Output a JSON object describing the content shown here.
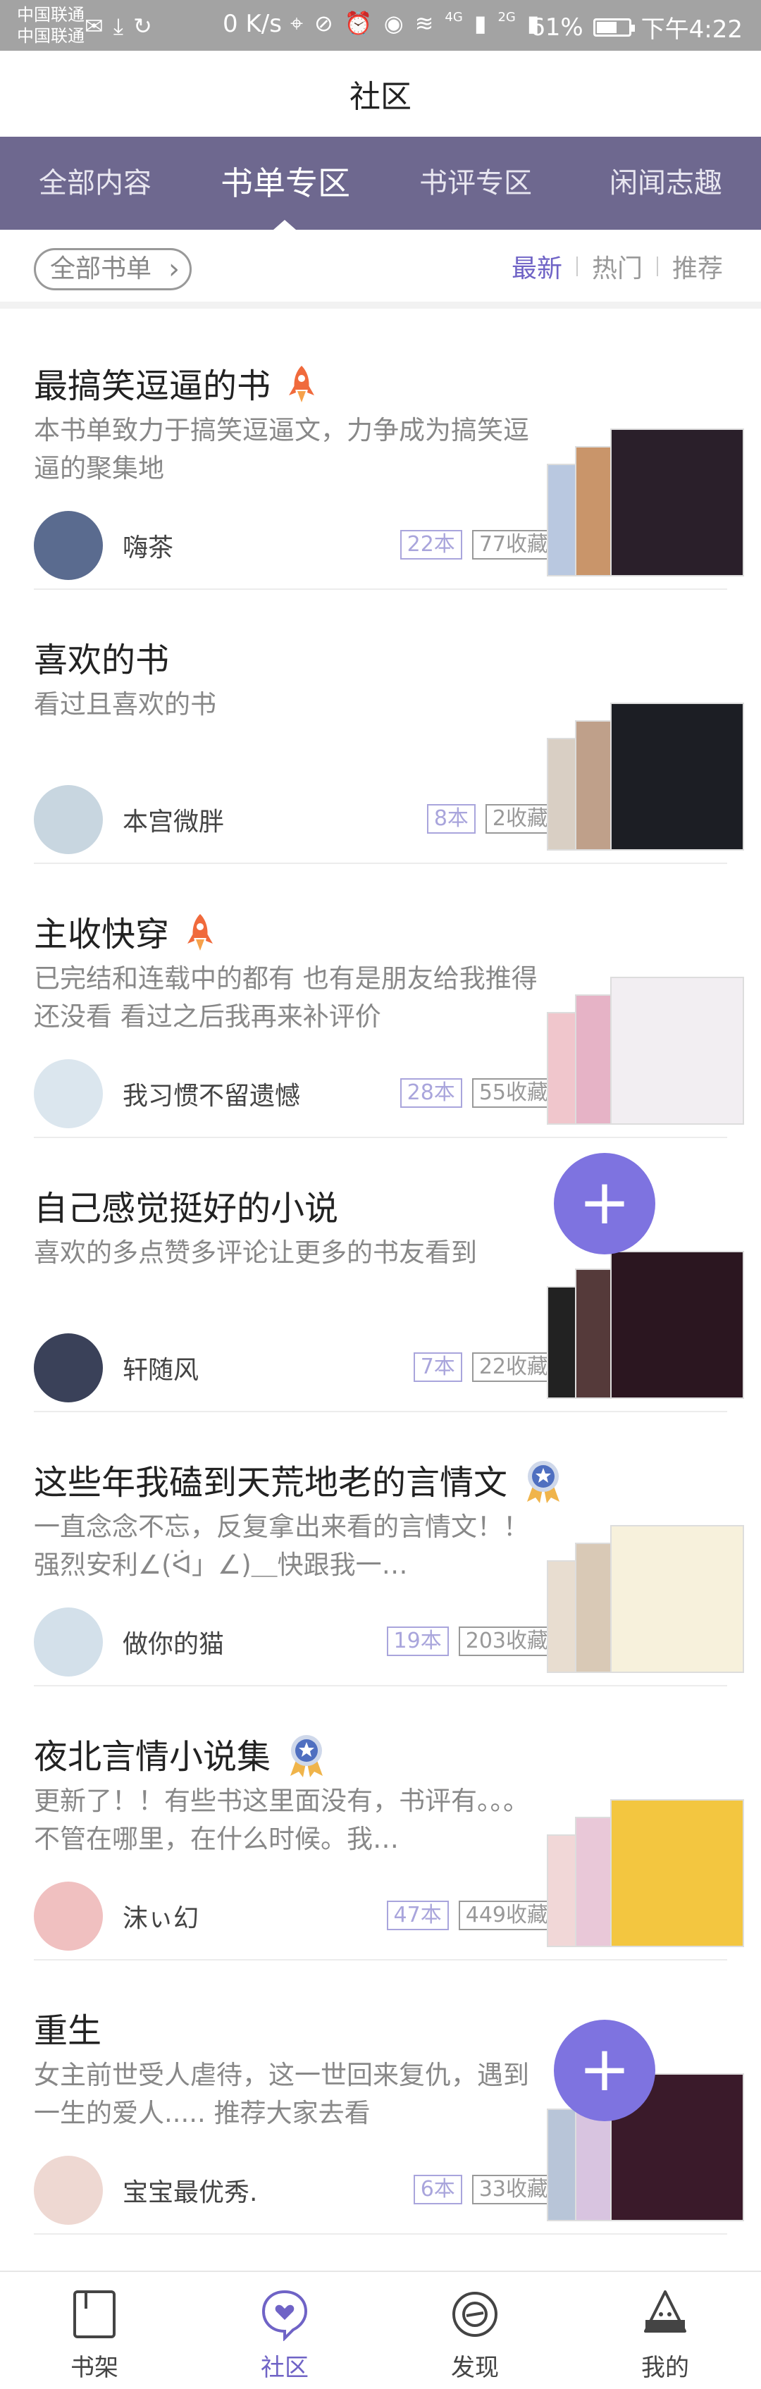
{
  "status_bar": {
    "carrier_1": "中国联通",
    "carrier_2": "中国联通",
    "speed": "0 K/s",
    "network_1": "4G",
    "network_2": "2G",
    "battery": "61%",
    "time": "下午4:22"
  },
  "page_title": "社区",
  "tabs": [
    {
      "label": "全部内容",
      "active": false
    },
    {
      "label": "书单专区",
      "active": true
    },
    {
      "label": "书评专区",
      "active": false
    },
    {
      "label": "闲闻志趣",
      "active": false
    }
  ],
  "filter": {
    "all_books_label": "全部书单",
    "sort_options": [
      {
        "label": "最新",
        "active": true
      },
      {
        "label": "热门",
        "active": false
      },
      {
        "label": "推荐",
        "active": false
      }
    ]
  },
  "booklists": [
    {
      "title": "最搞笑逗逼的书",
      "badge": "rocket",
      "desc": "本书单致力于搞笑逗逼文，力争成为搞笑逗逼的聚集地",
      "user": "嗨茶",
      "books": "22本",
      "favs": "77收藏",
      "avatar_color": "#5a6b8f",
      "covers": [
        "#b9c8e0",
        "#c9956a",
        "#2a1f2a"
      ]
    },
    {
      "title": "喜欢的书",
      "badge": "",
      "desc": "看过且喜欢的书",
      "user": "本宫微胖",
      "books": "8本",
      "favs": "2收藏",
      "avatar_color": "#c8d6e0",
      "covers": [
        "#d9cfc4",
        "#bfa08a",
        "#1c1e24"
      ]
    },
    {
      "title": "主收快穿",
      "badge": "rocket",
      "desc": "已完结和连载中的都有 也有是朋友给我推得还没看 看过之后我再来补评价",
      "user": "我习惯不留遗憾",
      "books": "28本",
      "favs": "55收藏",
      "avatar_color": "#dbe6ee",
      "covers": [
        "#f0c6cc",
        "#e6b3c6",
        "#f2eef2"
      ]
    },
    {
      "title": "自己感觉挺好的小说",
      "badge": "",
      "desc": "喜欢的多点赞多评论让更多的书友看到",
      "user": "轩随风",
      "books": "7本",
      "favs": "22收藏",
      "avatar_color": "#3a4159",
      "covers": [
        "#222222",
        "#553a3a",
        "#2b1620"
      ]
    },
    {
      "title": "这些年我磕到天荒地老的言情文",
      "badge": "medal",
      "desc": "一直念念不忘，反复拿出来看的言情文！！强烈安利∠(ᐛ」∠)＿快跟我一…",
      "user": "做你的猫",
      "books": "19本",
      "favs": "203收藏",
      "avatar_color": "#d3e0ea",
      "covers": [
        "#e8ddd0",
        "#d9c9b6",
        "#f7f1dc"
      ]
    },
    {
      "title": "夜北言情小说集",
      "badge": "medal",
      "desc": "更新了！！有些书这里面没有，书评有。。。不管在哪里，在什么时候。我…",
      "user": "沫ぃ幻",
      "books": "47本",
      "favs": "449收藏",
      "avatar_color": "#f0c0c0",
      "covers": [
        "#f1d7d7",
        "#e9c8d8",
        "#f3c640"
      ]
    },
    {
      "title": "重生",
      "badge": "",
      "desc": "女主前世受人虐待，这一世回来复仇，遇到一生的爱人..... 推荐大家去看",
      "user": "宝宝最优秀.",
      "books": "6本",
      "favs": "33收藏",
      "avatar_color": "#eed8d2",
      "covers": [
        "#b8c5d8",
        "#d8c4e0",
        "#3a1a2a"
      ]
    }
  ],
  "fab_label": "+",
  "bottom_nav": [
    {
      "label": "书架",
      "icon": "bookshelf-icon",
      "active": false
    },
    {
      "label": "社区",
      "icon": "community-icon",
      "active": true
    },
    {
      "label": "发现",
      "icon": "discover-icon",
      "active": false
    },
    {
      "label": "我的",
      "icon": "profile-icon",
      "active": false
    }
  ],
  "colors": {
    "accent": "#6f63c6",
    "tabbar": "#6e688f",
    "fab": "#7e73e0"
  }
}
